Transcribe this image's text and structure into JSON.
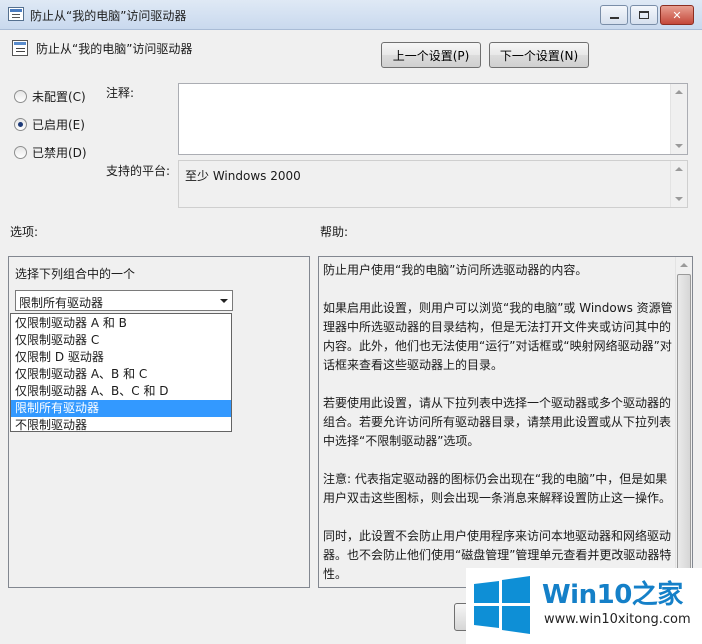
{
  "window": {
    "title": "防止从“我的电脑”访问驱动器"
  },
  "header": {
    "title": "防止从“我的电脑”访问驱动器",
    "prev_button": "上一个设置(P)",
    "next_button": "下一个设置(N)"
  },
  "state": {
    "not_configured": "未配置(C)",
    "enabled": "已启用(E)",
    "disabled": "已禁用(D)",
    "selected": "enabled"
  },
  "comment": {
    "label": "注释:",
    "value": ""
  },
  "platform": {
    "label": "支持的平台:",
    "value": "至少 Windows 2000"
  },
  "options": {
    "label": "选项:",
    "choose_label": "选择下列组合中的一个",
    "combo_value": "限制所有驱动器",
    "dropdown_items": [
      "仅限制驱动器 A 和 B",
      "仅限制驱动器 C",
      "仅限制 D 驱动器",
      "仅限制驱动器 A、B 和 C",
      "仅限制驱动器 A、B、C 和 D",
      "限制所有驱动器",
      "不限制驱动器"
    ],
    "selected_index": 5
  },
  "help": {
    "label": "帮助:",
    "paragraphs": [
      "防止用户使用“我的电脑”访问所选驱动器的内容。",
      "如果启用此设置，则用户可以浏览“我的电脑”或 Windows 资源管理器中所选驱动器的目录结构，但是无法打开文件夹或访问其中的内容。此外，他们也无法使用“运行”对话框或“映射网络驱动器”对话框来查看这些驱动器上的目录。",
      "若要使用此设置，请从下拉列表中选择一个驱动器或多个驱动器的组合。若要允许访问所有驱动器目录，请禁用此设置或从下拉列表中选择“不限制驱动器”选项。",
      "注意: 代表指定驱动器的图标仍会出现在“我的电脑”中，但是如果用户双击这些图标，则会出现一条消息来解释设置防止这一操作。",
      "同时，此设置不会防止用户使用程序来访问本地驱动器和网络驱动器。也不会防止他们使用“磁盘管理”管理单元查看并更改驱动器特性。"
    ]
  },
  "watermark": {
    "title": "Win10之家",
    "url": "www.win10xitong.com",
    "brand_color": "#0e8fd6"
  }
}
